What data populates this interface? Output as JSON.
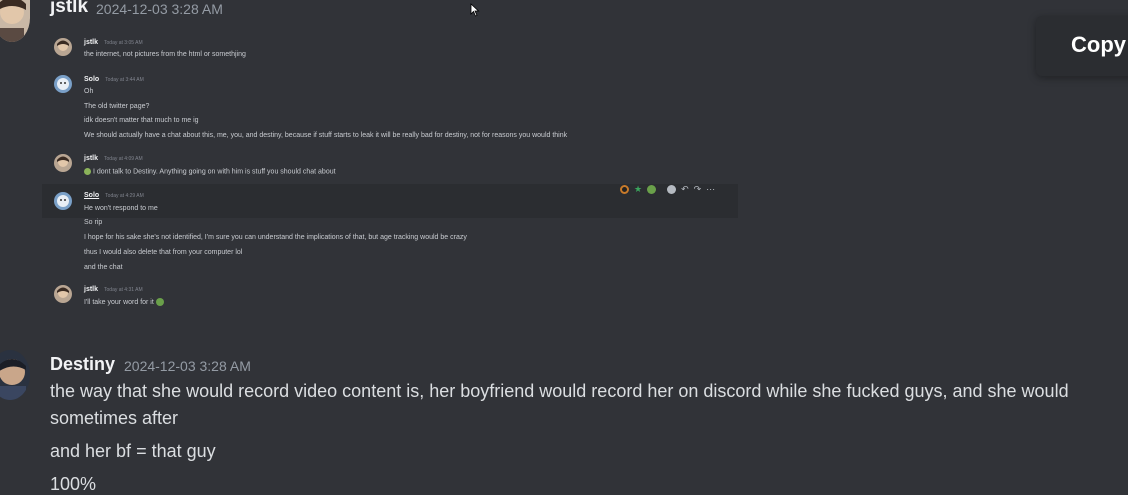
{
  "top_message": {
    "author": "jstlk",
    "timestamp": "2024-12-03 3:28 AM"
  },
  "screenshot": {
    "messages": [
      {
        "author": "jstlk",
        "timestamp": "Today at 3:05 AM",
        "lines": [
          "the internet, not pictures from the html or somethjing"
        ]
      },
      {
        "author": "Solo",
        "timestamp": "Today at 3:44 AM",
        "lines": [
          "Oh",
          "The old twitter page?",
          "idk doesn't matter that much to me ig",
          "We should actually have a chat about this, me, you, and destiny, because if stuff starts to leak it will be really bad for destiny, not for reasons you would think"
        ]
      },
      {
        "author": "jstlk",
        "timestamp": "Today at 4:09 AM",
        "lines": [
          "I dont talk to Destiny. Anything going on with him is stuff you should chat about"
        ]
      },
      {
        "author": "Solo",
        "timestamp": "Today at 4:29 AM",
        "lines": [
          "He won't respond to me",
          "So rip",
          "I hope for his sake she's not identified, I'm sure you can understand the implications of that, but age tracking would be crazy",
          "thus I would also delete that from your computer lol",
          "and the chat"
        ]
      },
      {
        "author": "jstlk",
        "timestamp": "Today at 4:31 AM",
        "lines": [
          "I'll take your word for it"
        ]
      }
    ],
    "toolbar_icons": [
      "reaction-icon",
      "star-icon",
      "emoji-icon",
      "add-reaction-icon",
      "reply-icon",
      "forward-icon",
      "more-icon"
    ]
  },
  "bottom_message": {
    "author": "Destiny",
    "timestamp": "2024-12-03 3:28 AM",
    "lines": [
      "the way that she would record video content is, her boyfriend would record her on discord while she fucked guys, and she would",
      "sometimes after",
      "and her bf = that guy",
      "100%"
    ]
  },
  "copy_button": {
    "label": "Copy"
  }
}
